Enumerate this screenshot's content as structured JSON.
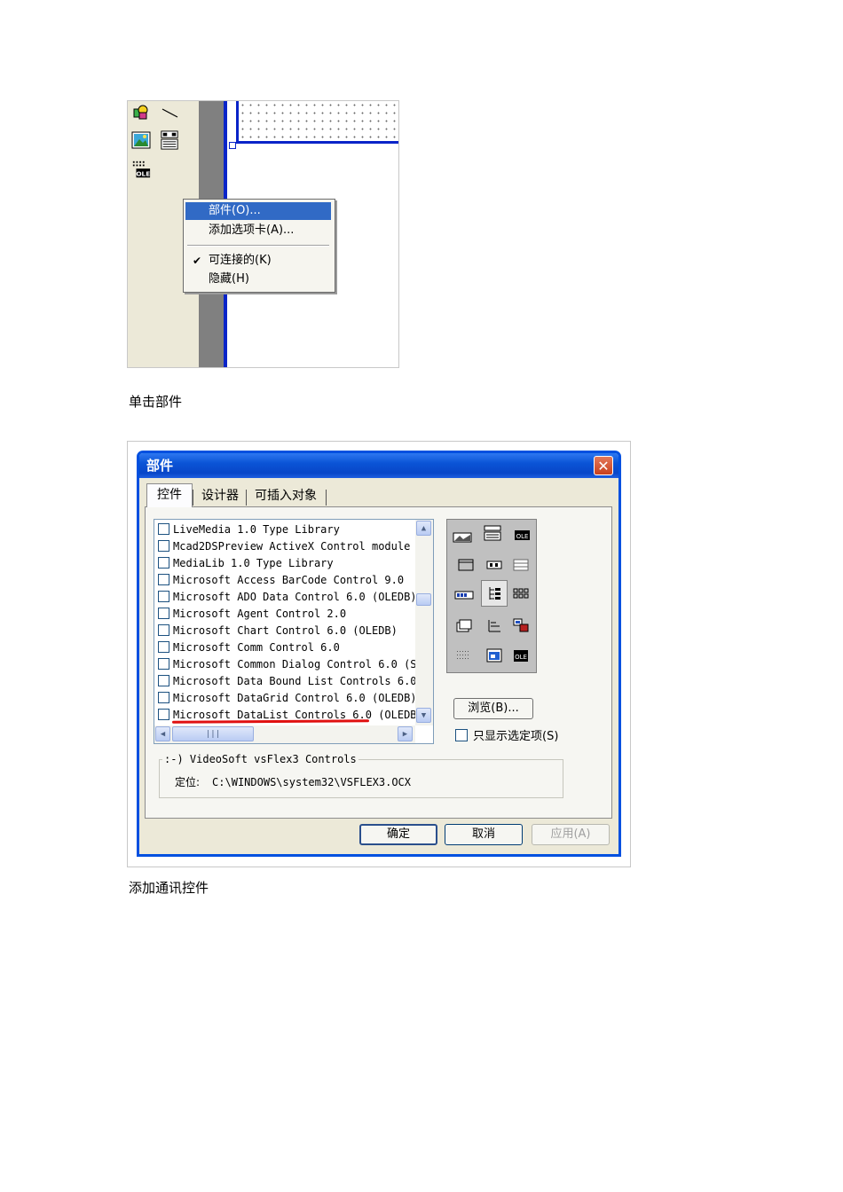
{
  "screenshot1": {
    "context_menu": {
      "items": [
        {
          "label": "部件(O)...",
          "selected": true,
          "checked": false
        },
        {
          "label": "添加选项卡(A)...",
          "selected": false,
          "checked": false
        },
        {
          "label": "可连接的(K)",
          "selected": false,
          "checked": true
        },
        {
          "label": "隐藏(H)",
          "selected": false,
          "checked": false
        }
      ],
      "check_glyph": "✔"
    },
    "toolbox_icons": [
      "shapes-icon",
      "line-icon",
      "image-icon",
      "hscroll-control-icon",
      "ole-icon"
    ]
  },
  "caption1": "单击部件",
  "dialog": {
    "title": "部件",
    "close_glyph": "✕",
    "tabs": [
      "控件",
      "设计器",
      "可插入对象"
    ],
    "list_items": [
      "LiveMedia 1.0 Type Library",
      "Mcad2DSPreview ActiveX Control module",
      "MediaLib 1.0 Type Library",
      "Microsoft Access BarCode Control 9.0",
      "Microsoft ADO Data Control 6.0 (OLEDB)",
      "Microsoft Agent Control 2.0",
      "Microsoft Chart Control 6.0 (OLEDB)",
      "Microsoft Comm Control 6.0",
      "Microsoft Common Dialog Control 6.0 (S",
      "Microsoft Data Bound List Controls 6.0",
      "Microsoft DataGrid Control 6.0 (OLEDB)",
      "Microsoft DataList Controls 6.0 (OLEDB"
    ],
    "highlighted_item": "Microsoft Comm Control 6.0",
    "annotation_color": "#e01010",
    "scroll": {
      "up": "▲",
      "down": "▼",
      "left": "◀",
      "right": "▶",
      "grip": "|||"
    },
    "browse_button": "浏览(B)...",
    "show_selected_label": "只显示选定项(S)",
    "info_title": ":-) VideoSoft vsFlex3 Controls",
    "info_location_label": "定位:",
    "info_location_value": "C:\\WINDOWS\\system32\\VSFLEX3.OCX",
    "buttons": {
      "ok": "确定",
      "cancel": "取消",
      "apply": "应用(A)"
    },
    "title_color": "#0b54d6"
  },
  "caption2": "添加通讯控件"
}
